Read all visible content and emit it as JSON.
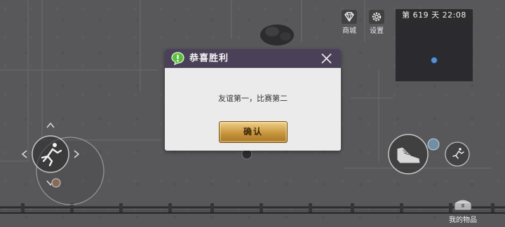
{
  "hud": {
    "shop_label": "商城",
    "settings_label": "设置",
    "day_time": "第 619 天  22:08",
    "shop_icon": "diamond-icon",
    "settings_icon": "gear-icon"
  },
  "dialog": {
    "title": "恭喜胜利",
    "message": "友谊第一，比赛第二",
    "confirm_label": "确认",
    "badge_icon": "exclamation-badge-icon",
    "close_icon": "close-icon",
    "header_color": "#4a4158",
    "button_color": "#c8963e"
  },
  "controls": {
    "run_icon": "running-man-icon",
    "sneak_icon": "shoe-icon",
    "sprint_icon": "running-man-icon"
  },
  "inventory": {
    "label": "我的物品",
    "icon": "chest-icon"
  }
}
